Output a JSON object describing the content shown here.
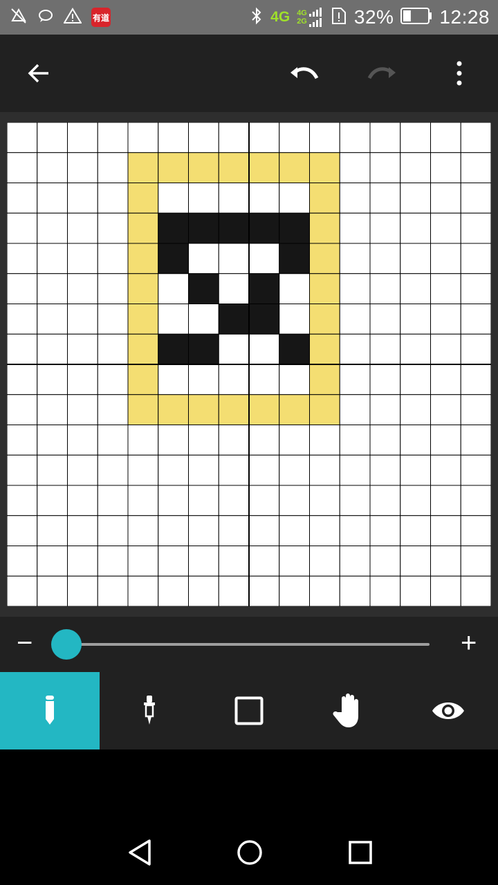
{
  "status_bar": {
    "network_label": "4G",
    "network_sub_top": "4G",
    "network_sub_bottom": "2G",
    "battery_percent": "32%",
    "battery_level": 0.32,
    "time": "12:28",
    "app_badge": "有道"
  },
  "appbar": {
    "back_icon": "arrow-left-icon",
    "undo_icon": "undo-icon",
    "redo_icon": "redo-icon",
    "redo_enabled": false,
    "menu_icon": "more-vert-icon"
  },
  "canvas": {
    "columns": 16,
    "rows": 16,
    "palette": {
      "0": "#ffffff",
      "1": "#f4de72",
      "2": "#161616"
    },
    "line_color": "#000000",
    "pixels": [
      "0000000000000000",
      "0000111111100000",
      "0000100000100000",
      "0000122222100000",
      "0000120002100000",
      "0000102020100000",
      "0000100220100000",
      "0000122002100000",
      "0000100000100000",
      "0000111111100000",
      "0000000000000000",
      "0000000000000000",
      "0000000000000000",
      "0000000000000000",
      "0000000000000000",
      "0000000000000000"
    ]
  },
  "zoom": {
    "minus_label": "−",
    "plus_label": "+",
    "value": 0,
    "accent": "#23b7c3"
  },
  "tools": [
    {
      "name": "pencil",
      "icon": "pencil-icon",
      "active": true
    },
    {
      "name": "eyedropper",
      "icon": "eyedropper-icon",
      "active": false
    },
    {
      "name": "rectangle",
      "icon": "square-outline-icon",
      "active": false
    },
    {
      "name": "pan",
      "icon": "hand-icon",
      "active": false
    },
    {
      "name": "preview",
      "icon": "eye-icon",
      "active": false
    }
  ],
  "nav": {
    "back": "triangle-back-icon",
    "home": "circle-home-icon",
    "recents": "square-recents-icon"
  }
}
